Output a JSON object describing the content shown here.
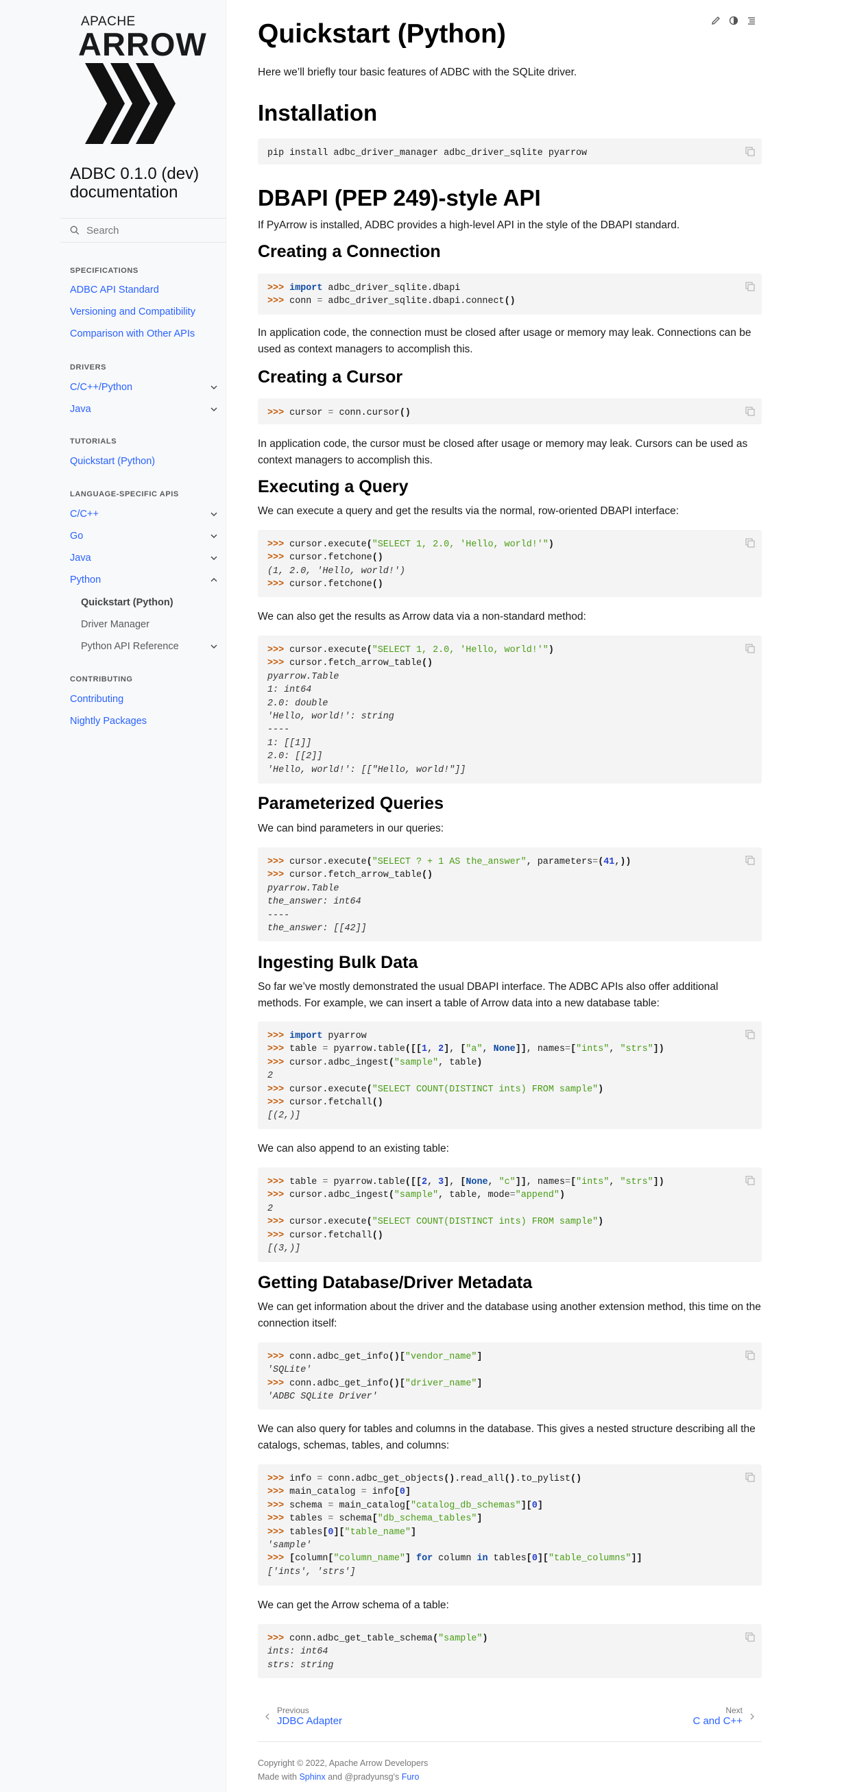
{
  "sidebar": {
    "logo_top": "APACHE",
    "logo_word": "ARROW",
    "title": "ADBC 0.1.0 (dev) documentation",
    "search_placeholder": "Search",
    "sections": [
      {
        "caption": "SPECIFICATIONS",
        "items": [
          "ADBC API Standard",
          "Versioning and Compatibility",
          "Comparison with Other APIs"
        ]
      },
      {
        "caption": "DRIVERS",
        "items": [
          "C/C++/Python",
          "Java"
        ]
      },
      {
        "caption": "TUTORIALS",
        "items": [
          "Quickstart (Python)"
        ]
      },
      {
        "caption": "LANGUAGE-SPECIFIC APIS",
        "items": [
          "C/C++",
          "Go",
          "Java",
          "Python",
          "Quickstart (Python)",
          "Driver Manager",
          "Python API Reference"
        ]
      },
      {
        "caption": "CONTRIBUTING",
        "items": [
          "Contributing",
          "Nightly Packages"
        ]
      }
    ]
  },
  "page": {
    "title": "Quickstart (Python)",
    "intro": "Here we’ll briefly tour basic features of ADBC with the SQLite driver.",
    "installation": "Installation",
    "install_cmd": "pip install adbc_driver_manager adbc_driver_sqlite pyarrow",
    "dbapi": "DBAPI (PEP 249)-style API",
    "dbapi_intro": "If PyArrow is installed, ADBC provides a high-level API in the style of the DBAPI standard.",
    "creating_connection": "Creating a Connection",
    "conn_note": "In application code, the connection must be closed after usage or memory may leak. Connections can be used as context managers to accomplish this.",
    "creating_cursor": "Creating a Cursor",
    "cursor_note": "In application code, the cursor must be closed after usage or memory may leak. Cursors can be used as context managers to accomplish this.",
    "executing_query": "Executing a Query",
    "exec_intro": "We can execute a query and get the results via the normal, row-oriented DBAPI interface:",
    "arrow_intro": "We can also get the results as Arrow data via a non-standard method:",
    "param_queries": "Parameterized Queries",
    "param_intro": "We can bind parameters in our queries:",
    "ingest": "Ingesting Bulk Data",
    "ingest_intro": "So far we’ve mostly demonstrated the usual DBAPI interface. The ADBC APIs also offer additional methods. For example, we can insert a table of Arrow data into a new database table:",
    "append_intro": "We can also append to an existing table:",
    "metadata": "Getting Database/Driver Metadata",
    "metadata_intro": "We can get information about the driver and the database using another extension method, this time on the connection itself:",
    "objects_intro": "We can also query for tables and columns in the database. This gives a nested structure describing all the catalogs, schemas, tables, and columns:",
    "schema_intro": "We can get the Arrow schema of a table:"
  },
  "footer": {
    "prev_label": "Previous",
    "prev_title": "JDBC Adapter",
    "next_label": "Next",
    "next_title": "C and C++",
    "copyright": "Copyright © 2022, Apache Arrow Developers",
    "made_with": "Made with",
    "sphinx": "Sphinx",
    "and": "and",
    "pradyunsg": "@pradyunsg's",
    "furo": "Furo"
  },
  "colors": {
    "link": "#2962ff",
    "prompt": "#c65d09",
    "string": "#4a9d14",
    "keyword": "#0e4aa1"
  }
}
